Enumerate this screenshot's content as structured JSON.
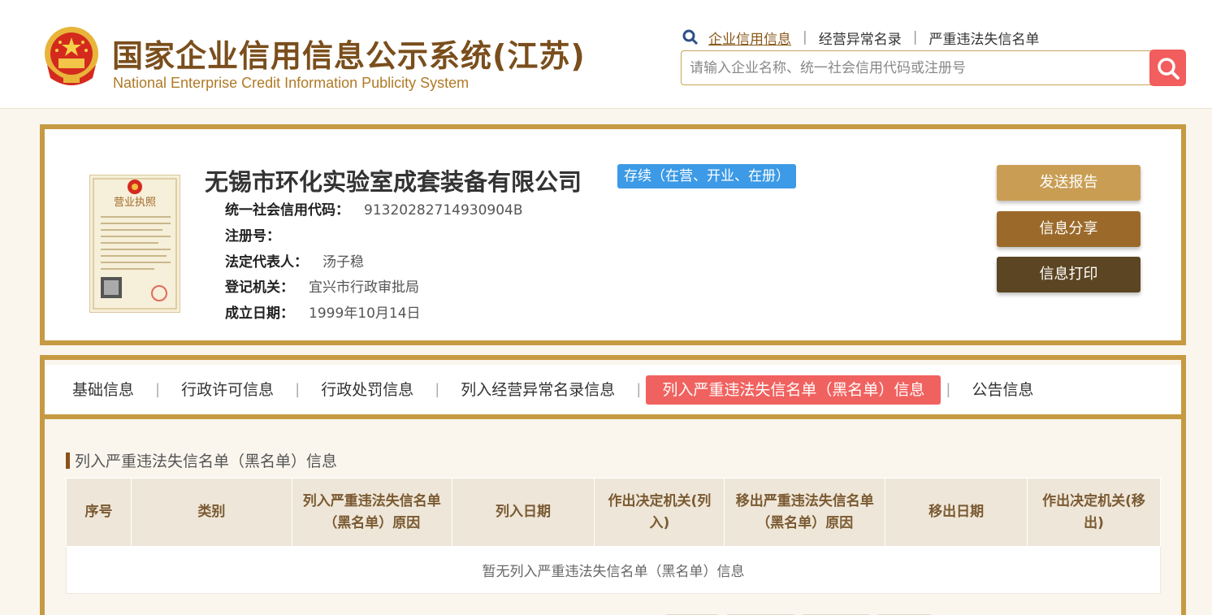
{
  "header": {
    "title": "国家企业信用信息公示系统(江苏)",
    "subtitle": "National Enterprise Credit Information Publicity System",
    "links": [
      "企业信用信息",
      "经营异常名录",
      "严重违法失信名单"
    ],
    "search_placeholder": "请输入企业名称、统一社会信用代码或注册号",
    "colors": {
      "title": "#7a4e1c",
      "search_button": "#f25d5d"
    }
  },
  "company": {
    "name": "无锡市环化实验室成套装备有限公司",
    "status": "存续（在营、开业、在册）",
    "fields": [
      {
        "label": "统一社会信用代码：",
        "value": "91320282714930904B"
      },
      {
        "label": "注册号：",
        "value": ""
      },
      {
        "label": "法定代表人：",
        "value": "汤子稳"
      },
      {
        "label": "登记机关：",
        "value": "宜兴市行政审批局"
      },
      {
        "label": "成立日期：",
        "value": "1999年10月14日"
      }
    ],
    "license_title": "营业执照",
    "actions": [
      "发送报告",
      "信息分享",
      "信息打印"
    ]
  },
  "tabs": {
    "items": [
      "基础信息",
      "行政许可信息",
      "行政处罚信息",
      "列入经营异常名录信息",
      "列入严重违法失信名单（黑名单）信息",
      "公告信息"
    ],
    "active": 4
  },
  "section": {
    "title": "列入严重违法失信名单（黑名单）信息",
    "columns": [
      "序号",
      "类别",
      "列入严重违法失信名单（黑名单）原因",
      "列入日期",
      "作出决定机关(列入)",
      "移出严重违法失信名单（黑名单）原因",
      "移出日期",
      "作出决定机关(移出)"
    ],
    "empty_message": "暂无列入严重违法失信名单（黑名单）信息"
  }
}
